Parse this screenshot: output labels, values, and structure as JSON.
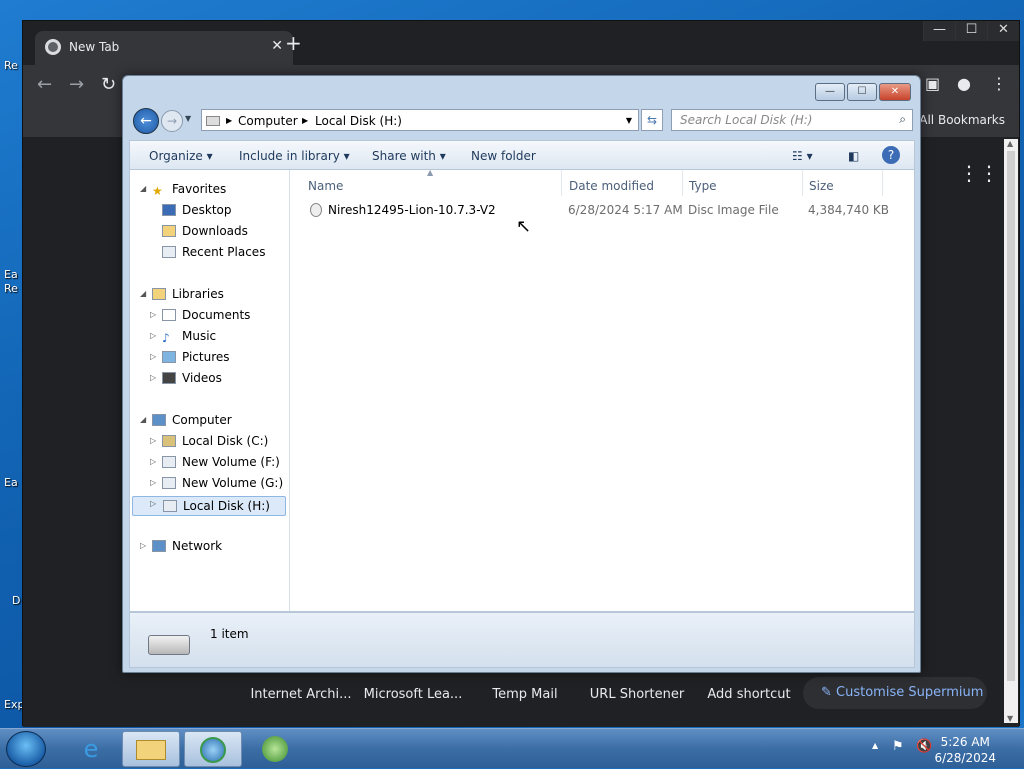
{
  "browser": {
    "tab_title": "New Tab",
    "new_tab_symbol": "+",
    "all_bookmarks": "All Bookmarks",
    "shortcuts": [
      "Internet Archi...",
      "Microsoft Lea...",
      "Temp Mail",
      "URL Shortener",
      "Add shortcut"
    ],
    "customise_label": "Customise Supermium"
  },
  "explorer": {
    "breadcrumb": [
      "Computer",
      "Local Disk (H:)"
    ],
    "search_placeholder": "Search Local Disk (H:)",
    "commands": {
      "organize": "Organize",
      "include_in_library": "Include in library",
      "share_with": "Share with",
      "new_folder": "New folder"
    },
    "nav": {
      "favorites": "Favorites",
      "desktop": "Desktop",
      "downloads": "Downloads",
      "recent_places": "Recent Places",
      "libraries": "Libraries",
      "documents": "Documents",
      "music": "Music",
      "pictures": "Pictures",
      "videos": "Videos",
      "computer": "Computer",
      "local_disk_c": "Local Disk (C:)",
      "new_volume_f": "New Volume (F:)",
      "new_volume_g": "New Volume (G:)",
      "local_disk_h": "Local Disk (H:)",
      "network": "Network"
    },
    "columns": {
      "name": "Name",
      "date_modified": "Date modified",
      "type": "Type",
      "size": "Size"
    },
    "files": [
      {
        "name": "Niresh12495-Lion-10.7.3-V2",
        "date_modified": "6/28/2024 5:17 AM",
        "type": "Disc Image File",
        "size": "4,384,740 KB"
      }
    ],
    "status_text": "1 item"
  },
  "taskbar": {
    "time": "5:26 AM",
    "date": "6/28/2024"
  },
  "desktop_fragments": [
    "Re",
    "Ea",
    "Re",
    "Ea",
    "D",
    "Exp"
  ],
  "colors": {
    "desktop_blue": "#1264b4",
    "chrome_dark": "#35363a",
    "explorer_frame": "#c4d6ea",
    "selection": "#dce9f8"
  }
}
